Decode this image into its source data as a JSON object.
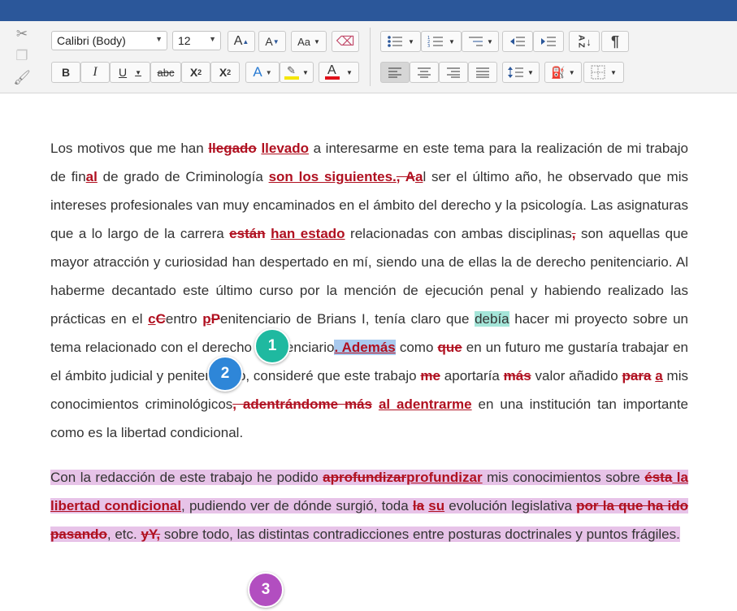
{
  "toolbar": {
    "font_name": "Calibri (Body)",
    "font_size": "12",
    "bold": "B",
    "italic": "I",
    "underline": "U",
    "strikethrough": "abc",
    "subscript": "X",
    "subscript_mark": "2",
    "superscript": "X",
    "superscript_mark": "2",
    "grow_font": "A",
    "shrink_font": "A",
    "change_case": "Aa",
    "text_effects": "A",
    "font_color": "A",
    "sort": "A Z",
    "pilcrow": "¶",
    "highlight_color": "#f5e600",
    "font_color_value": "#e0101a"
  },
  "document": {
    "p1": {
      "s1": "Los motivos que me han ",
      "d1": "llegado",
      "s2": " ",
      "i1": "llevado",
      "s3": " a interesarme en este tema para la realización de mi trabajo de fin",
      "i2": "al",
      "s4": " de grado de Criminología ",
      "i3": "son los siguientes.",
      "d2": ", A",
      "i4": "a",
      "s5": "l ser el último año, he observado que mis intereses profesionales van muy encaminados en el ámbito del derecho y la psicología. Las asignaturas que a lo largo de la carrera ",
      "d3": "están",
      "s6": " ",
      "i5": "han estado",
      "s7": " relacionadas con ambas disciplinas",
      "d4": ",",
      "s8": " son aquellas que mayor atracción y curiosidad han despertado en mí, siendo una de ellas la de derecho penitenciario. Al haberme decantado este último curso por la mención de ejecución penal y habiendo realizado las prácticas en el ",
      "i6": "c",
      "d5": "C",
      "s9": "entro ",
      "i7": "p",
      "d6": "P",
      "s10": "enitenciario de Brians I, tenía claro que ",
      "h1": "debía",
      "s11": " hacer mi proyecto sobre un tema relacionado con el derecho penitenciario",
      "i8": ". Además",
      "s12": " como ",
      "d7": "que",
      "s13": " en un futuro me gustaría trabajar en el ámbito judicial y penitenciario, consideré que este trabajo ",
      "d8": "me",
      "s14": " aportaría ",
      "d9": "más",
      "s15": " valor añadido ",
      "d10": "para",
      "s16": " ",
      "i9": "a",
      "s17": " mis conocimientos criminológicos",
      "d11": ", adentrándome más",
      "s18": " ",
      "i10": "al adentrarme",
      "s19": " en una institución tan importante como es la libertad condicional."
    },
    "p2": {
      "s1": "Con la redacción de este trabajo he podido ",
      "d1": "aprofundizar",
      "i1": "profundizar",
      "s2": " mis conocimientos sobre ",
      "d2": "ésta",
      "i2": " la libertad condicional",
      "s3": ", pudiendo ver de dónde surgió, toda ",
      "d3": "la",
      "s4": " ",
      "i3": "su",
      "s5": " evolución legislativa ",
      "d4": "por la que ha ido pasando",
      "s6": ", etc. ",
      "d5": "yY,",
      "s7": " sobre todo, las distintas contradicciones entre posturas doctrinales y puntos frágiles."
    }
  },
  "badges": [
    {
      "label": "1",
      "color": "#1fb9a0"
    },
    {
      "label": "2",
      "color": "#2e86d8"
    },
    {
      "label": "3",
      "color": "#b24ec0"
    }
  ]
}
